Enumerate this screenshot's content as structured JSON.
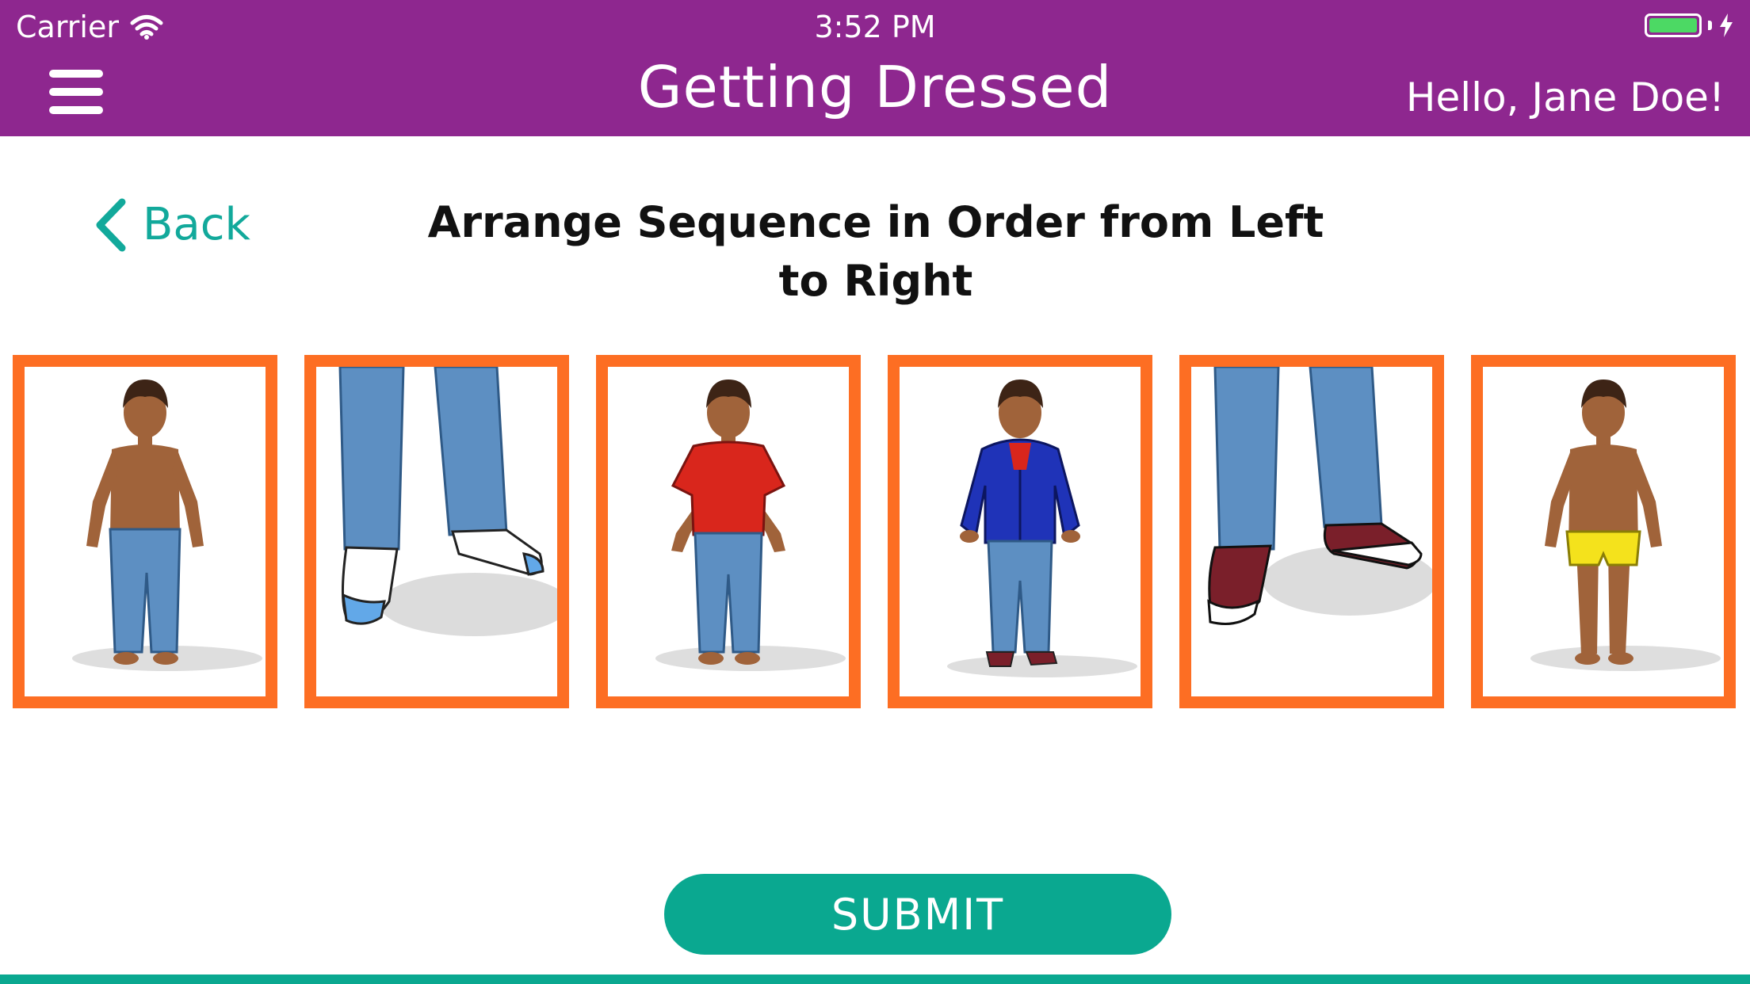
{
  "status_bar": {
    "carrier": "Carrier",
    "time": "3:52 PM",
    "battery_color": "#4cd964"
  },
  "header": {
    "title": "Getting Dressed",
    "greeting": "Hello, Jane Doe!",
    "menu_icon": "hamburger-menu-icon",
    "background_color": "#8e278f"
  },
  "nav": {
    "back_label": "Back",
    "back_icon": "chevron-left-icon",
    "accent_color": "#12a99b"
  },
  "activity": {
    "instruction": "Arrange Sequence in Order from Left to Right",
    "card_border_color": "#fd6e23",
    "cards": [
      {
        "depicts": "boy-in-jeans-shirtless"
      },
      {
        "depicts": "feet-in-socks-and-jeans"
      },
      {
        "depicts": "boy-in-red-tshirt-and-jeans"
      },
      {
        "depicts": "boy-in-blue-hoodie-jeans-and-sneakers"
      },
      {
        "depicts": "feet-in-sneakers-and-jeans"
      },
      {
        "depicts": "boy-in-yellow-underwear"
      }
    ]
  },
  "footer": {
    "submit_label": "SUBMIT",
    "button_color": "#0aa890"
  }
}
